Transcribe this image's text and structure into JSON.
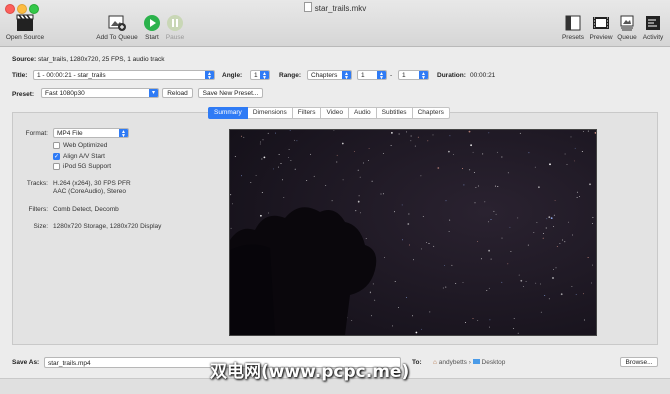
{
  "window": {
    "title": "star_trails.mkv"
  },
  "toolbar": {
    "open_source": "Open Source",
    "add_to_queue": "Add To Queue",
    "start": "Start",
    "pause": "Pause",
    "presets": "Presets",
    "preview": "Preview",
    "queue": "Queue",
    "activity": "Activity"
  },
  "source": {
    "label": "Source:",
    "value": "star_trails, 1280x720, 25 FPS, 1 audio track"
  },
  "title_row": {
    "title_label": "Title:",
    "title_value": "1 - 00:00:21 - star_trails",
    "angle_label": "Angle:",
    "angle_value": "1",
    "range_label": "Range:",
    "range_type": "Chapters",
    "range_from": "1",
    "range_sep": "-",
    "range_to": "1",
    "duration_label": "Duration:",
    "duration_value": "00:00:21"
  },
  "preset_row": {
    "label": "Preset:",
    "value": "Fast 1080p30",
    "reload": "Reload",
    "save_new": "Save New Preset..."
  },
  "tabs": [
    "Summary",
    "Dimensions",
    "Filters",
    "Video",
    "Audio",
    "Subtitles",
    "Chapters"
  ],
  "summary": {
    "format_label": "Format:",
    "format_value": "MP4 File",
    "web_optimized": "Web Optimized",
    "align_av": "Align A/V Start",
    "ipod": "iPod 5G Support",
    "tracks_label": "Tracks:",
    "tracks_line1": "H.264 (x264), 30 FPS PFR",
    "tracks_line2": "AAC (CoreAudio), Stereo",
    "filters_label": "Filters:",
    "filters_value": "Comb Detect, Decomb",
    "size_label": "Size:",
    "size_value": "1280x720 Storage, 1280x720 Display"
  },
  "save": {
    "label": "Save As:",
    "value": "star_trails.mp4",
    "to_label": "To:",
    "user": "andybetts",
    "sep": "›",
    "folder": "Desktop",
    "browse": "Browse..."
  },
  "watermark": "双电网(www.pcpc.me)",
  "colors": {
    "accent": "#2f7bf5",
    "start_green": "#2bb24c"
  }
}
